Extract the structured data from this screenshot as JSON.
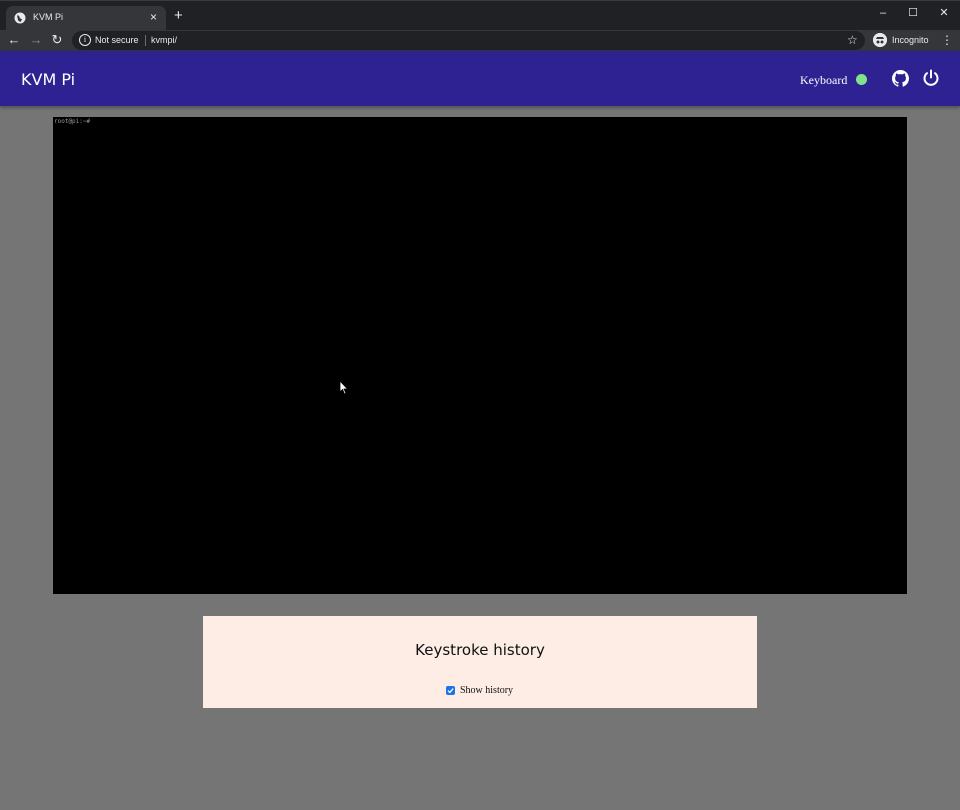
{
  "browser": {
    "tab_title": "KVM Pi",
    "tab_close": "×",
    "new_tab": "+",
    "window_controls": {
      "minimize": "–",
      "maximize": "☐",
      "close": "✕"
    },
    "security_label": "Not secure",
    "url": "kvmpi/",
    "profile_label": "Incognito",
    "icons": [
      "globe-icon",
      "back-icon",
      "forward-icon",
      "reload-icon",
      "info-icon",
      "star-icon",
      "incognito-icon",
      "menu-icon"
    ]
  },
  "appbar": {
    "title": "KVM Pi",
    "keyboard_label": "Keyboard",
    "keyboard_status_color": "#7ee38a",
    "background_color": "#2e2292"
  },
  "remote_screen": {
    "prompt": "root@pi:~#"
  },
  "history": {
    "title": "Keystroke history",
    "show_history_label": "Show history",
    "show_history_checked": true
  }
}
